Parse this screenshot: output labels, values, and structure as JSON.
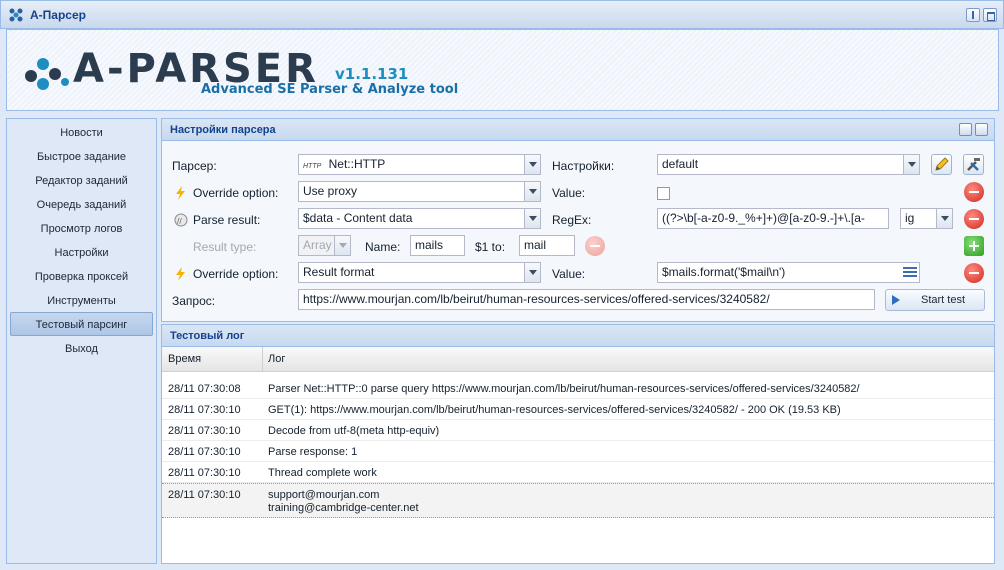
{
  "window": {
    "title": "A-Парсер"
  },
  "logo": {
    "text": "A-PARSER",
    "version": "v1.1.131",
    "subtitle": "Advanced SE Parser & Analyze tool"
  },
  "sidebar": {
    "items": [
      {
        "label": "Новости"
      },
      {
        "label": "Быстрое задание"
      },
      {
        "label": "Редактор заданий"
      },
      {
        "label": "Очередь заданий"
      },
      {
        "label": "Просмотр логов"
      },
      {
        "label": "Настройки"
      },
      {
        "label": "Проверка проксей"
      },
      {
        "label": "Инструменты"
      },
      {
        "label": "Тестовый парсинг",
        "active": true
      },
      {
        "label": "Выход"
      }
    ]
  },
  "settings_panel": {
    "title": "Настройки парсера",
    "parser_label": "Парсер:",
    "parser_value": "Net::HTTP",
    "parser_icon_text": "HTTP",
    "settings_label": "Настройки:",
    "settings_value": "default",
    "override1_label": "Override option:",
    "override1_value": "Use proxy",
    "value1_label": "Value:",
    "value1_checked": false,
    "parse_result_label": "Parse result:",
    "parse_result_value": "$data - Content data",
    "regex_label": "RegEx:",
    "regex_value": "((?>\\b[-a-z0-9._%+]+)@[a-z0-9.-]+\\.[a-",
    "regex_flags": "ig",
    "result_type_label": "Result type:",
    "result_type_value": "Array",
    "name_label": "Name:",
    "name_value": "mails",
    "s1to_label": "$1 to:",
    "s1to_value": "mail",
    "override2_label": "Override option:",
    "override2_value": "Result format",
    "value2_label": "Value:",
    "value2_value": "$mails.format('$mail\\n')",
    "query_label": "Запрос:",
    "query_value": "https://www.mourjan.com/lb/beirut/human-resources-services/offered-services/3240582/",
    "start_label": "Start test"
  },
  "log_panel": {
    "title": "Тестовый лог",
    "col_time": "Время",
    "col_log": "Лог",
    "rows": [
      {
        "time": "28/11 07:30:08",
        "msg": "Parser Net::HTTP::0 parse query https://www.mourjan.com/lb/beirut/human-resources-services/offered-services/3240582/"
      },
      {
        "time": "28/11 07:30:10",
        "msg": "GET(1): https://www.mourjan.com/lb/beirut/human-resources-services/offered-services/3240582/ - 200 OK (19.53 KB)"
      },
      {
        "time": "28/11 07:30:10",
        "msg": "Decode from utf-8(meta http-equiv)"
      },
      {
        "time": "28/11 07:30:10",
        "msg": "Parse response: 1"
      },
      {
        "time": "28/11 07:30:10",
        "msg": "Thread complete work"
      },
      {
        "time": "28/11 07:30:10",
        "msg": "support@mourjan.com",
        "msg2": "training@cambridge-center.net"
      }
    ]
  },
  "colors": {
    "accent": "#15428b",
    "border": "#99bbe8",
    "background": "#dfe8f6",
    "logo_blue": "#1e8dbf"
  }
}
